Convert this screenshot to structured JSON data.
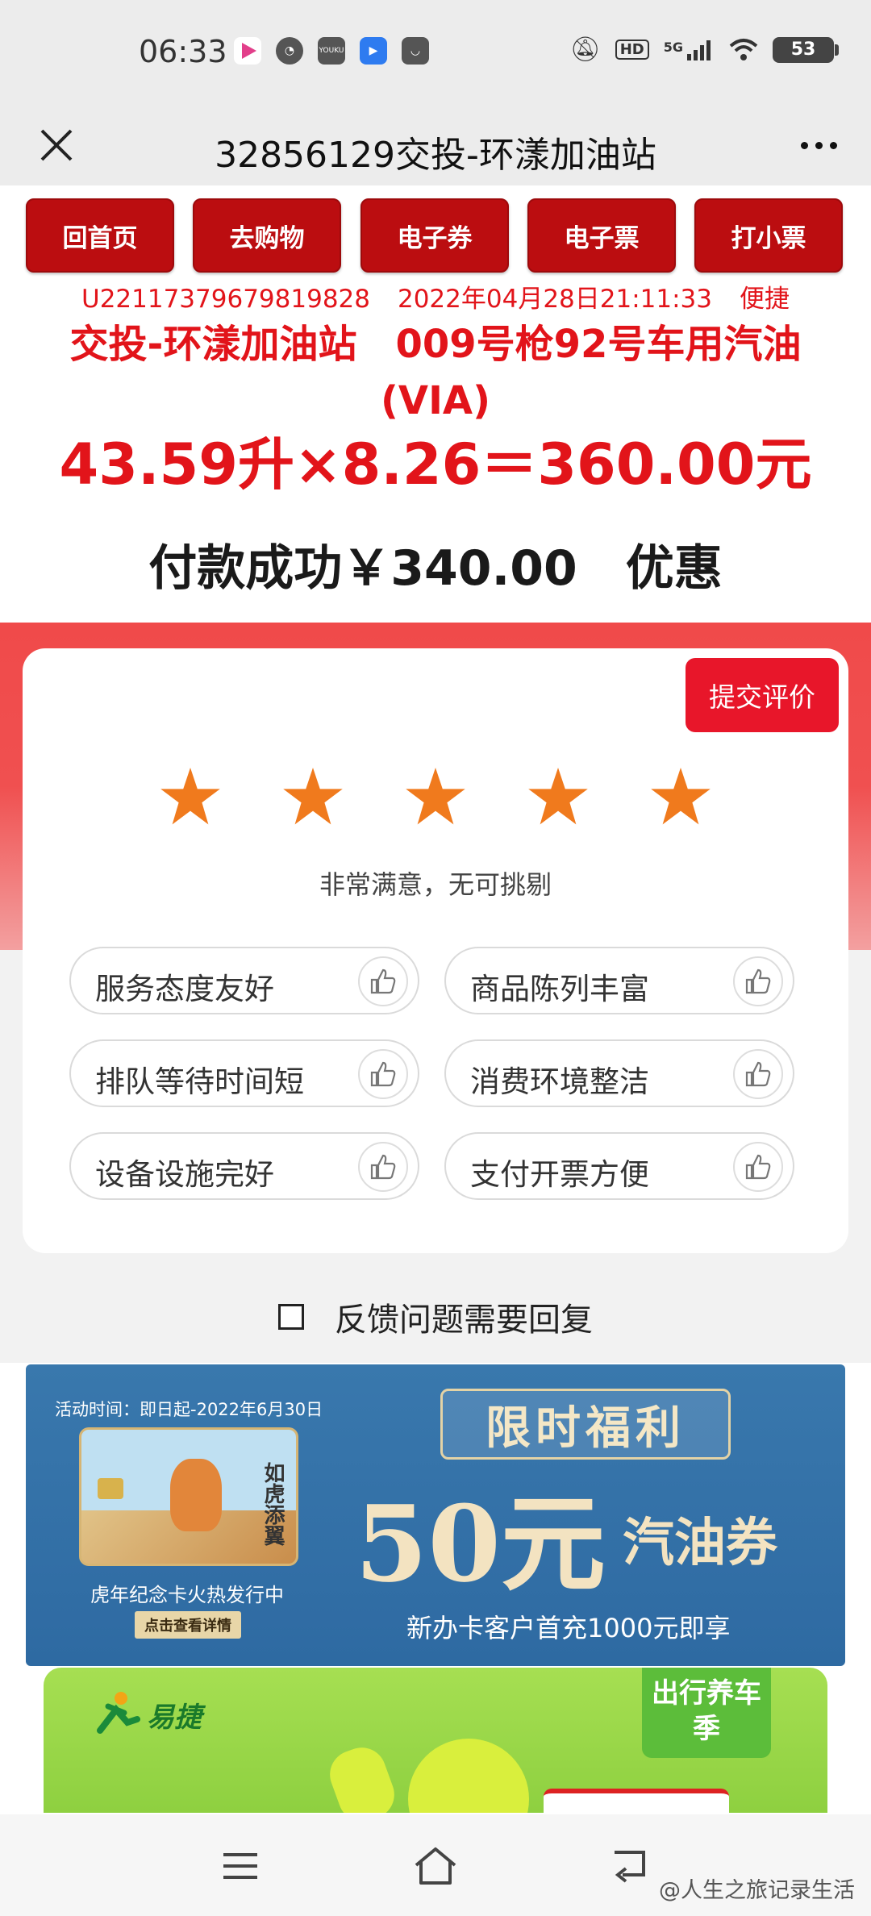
{
  "status_bar": {
    "time": "06:33",
    "network": "5G",
    "battery": "53",
    "hd": "HD"
  },
  "header": {
    "title": "32856129交投-环漾加油站"
  },
  "nav_buttons": [
    "回首页",
    "去购物",
    "电子券",
    "电子票",
    "打小票"
  ],
  "order": {
    "id": "U22117379679819828",
    "datetime": "2022年04月28日21:11:33",
    "method": "便捷",
    "station_line": "交投-环漾加油站　009号枪92号车用汽油(VIA)",
    "calculation": "43.59升×8.26＝360.00元",
    "paid": "付款成功￥340.00",
    "discount": "优惠"
  },
  "rating": {
    "submit_label": "提交评价",
    "stars": 5,
    "max_stars": 5,
    "star_color": "#f07a1d",
    "text": "非常满意，无可挑剔",
    "tags": [
      "服务态度友好",
      "商品陈列丰富",
      "排队等待时间短",
      "消费环境整洁",
      "设备设施完好",
      "支付开票方便"
    ]
  },
  "feedback": {
    "label": "反馈问题需要回复",
    "checked": false
  },
  "banner1": {
    "date": "活动时间：即日起-2022年6月30日",
    "title": "限时福利",
    "amount": "50元",
    "amount_tail": "汽油券",
    "subtitle": "新办卡客户首充1000元即享",
    "card_label": "虎年纪念卡火热发行中",
    "card_text": "如虎添翼",
    "detail_button": "点击查看详情"
  },
  "banner2": {
    "logo": "易捷",
    "badge": "出行养车季"
  },
  "watermark": "@人生之旅记录生活",
  "colors": {
    "nav_red": "#bb0d10",
    "text_red": "#e2141a",
    "submit_red": "#e8162a"
  }
}
